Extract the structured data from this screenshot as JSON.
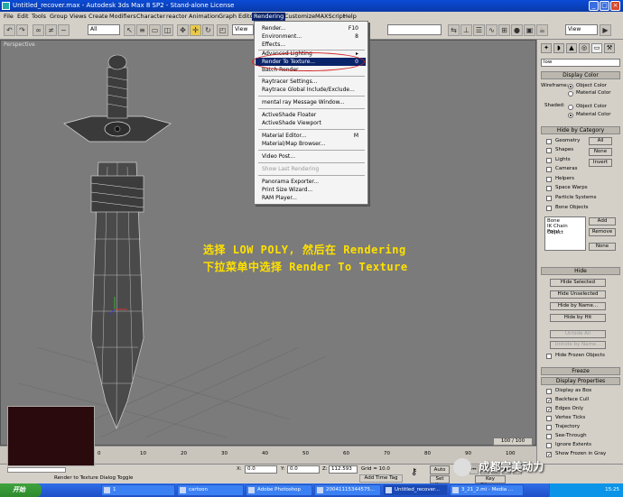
{
  "window": {
    "title": "Untitled_recover.max - Autodesk 3ds Max 8 SP2 - Stand-alone License"
  },
  "menu": [
    "File",
    "Edit",
    "Tools",
    "Group",
    "Views",
    "Create",
    "Modifiers",
    "Character",
    "reactor",
    "Animation",
    "Graph Editors",
    "Rendering",
    "Customize",
    "MAXScript",
    "Help"
  ],
  "toolbar": {
    "selection_filter": "All",
    "ref_coord": "View",
    "right_view": "View"
  },
  "viewport": {
    "label": "Perspective"
  },
  "rendering_menu": {
    "items": [
      {
        "label": "Render...",
        "shortcut": "F10"
      },
      {
        "label": "Environment...",
        "shortcut": "8"
      },
      {
        "label": "Effects...",
        "shortcut": ""
      },
      {
        "label": "Advanced Lighting",
        "shortcut": "▸"
      },
      {
        "label": "Render To Texture...",
        "shortcut": "0"
      },
      {
        "label": "Batch Render...",
        "shortcut": ""
      },
      {
        "label": "Raytracer Settings...",
        "shortcut": ""
      },
      {
        "label": "Raytrace Global Include/Exclude...",
        "shortcut": ""
      },
      {
        "label": "mental ray Message Window...",
        "shortcut": ""
      },
      {
        "label": "ActiveShade Floater",
        "shortcut": ""
      },
      {
        "label": "ActiveShade Viewport",
        "shortcut": ""
      },
      {
        "label": "Material Editor...",
        "shortcut": "M"
      },
      {
        "label": "Material/Map Browser...",
        "shortcut": ""
      },
      {
        "label": "Video Post...",
        "shortcut": ""
      },
      {
        "label": "Show Last Rendering",
        "shortcut": ""
      },
      {
        "label": "Panorama Exporter...",
        "shortcut": ""
      },
      {
        "label": "Print Size Wizard...",
        "shortcut": ""
      },
      {
        "label": "RAM Player...",
        "shortcut": ""
      }
    ]
  },
  "annotation": {
    "line1": "选择 LOW POLY, 然后在 Rendering",
    "line2": "下拉菜单中选择 Render To Texture"
  },
  "command_panel": {
    "name_field": "low",
    "display_color": {
      "header": "Display Color",
      "wireframe_label": "Wireframe:",
      "shaded_label": "Shaded:",
      "object_color": "Object Color",
      "material_color": "Material Color"
    },
    "hide_by_category": {
      "header": "Hide by Category",
      "items": [
        "Geometry",
        "Shapes",
        "Lights",
        "Cameras",
        "Helpers",
        "Space Warps",
        "Particle Systems",
        "Bone Objects"
      ],
      "all": "All",
      "none": "None",
      "invert": "Invert",
      "list": [
        "Bone",
        "IK Chain Object",
        "Point"
      ],
      "add": "Add",
      "remove": "Remove",
      "none2": "None"
    },
    "hide": {
      "header": "Hide",
      "buttons": [
        "Hide Selected",
        "Hide Unselected",
        "Hide by Name...",
        "Hide by Hit",
        "Unhide All",
        "Unhide by Name..."
      ],
      "frozen": "Hide Frozen Objects"
    },
    "freeze": {
      "header": "Freeze"
    },
    "display_properties": {
      "header": "Display Properties",
      "items": [
        "Display as Box",
        "Backface Cull",
        "Edges Only",
        "Vertex Ticks",
        "Trajectory",
        "See-Through",
        "Ignore Extents",
        "Show Frozen in Gray"
      ]
    }
  },
  "timeline": {
    "frame": "100 / 100",
    "ticks": [
      "0",
      "10",
      "20",
      "30",
      "40",
      "50",
      "60",
      "70",
      "80",
      "90",
      "100"
    ]
  },
  "status": {
    "prompt": "Render to Texture Dialog Toggle",
    "x": "0.0",
    "y": "0.0",
    "z": "112.593",
    "grid": "Grid = 10.0",
    "add_time_tag": "Add Time Tag",
    "auto_key": "Auto",
    "set_key": "Set Key",
    "key_filters": "Key Filters..."
  },
  "taskbar": {
    "start": "开始",
    "tasks": [
      "1",
      "cartoon",
      "Adobe Photoshop",
      "20041115344575...",
      "Untitled_recover...",
      "3_21_2.mi - Media ..."
    ],
    "clock": "15:25"
  },
  "watermark": "成都完美动力"
}
